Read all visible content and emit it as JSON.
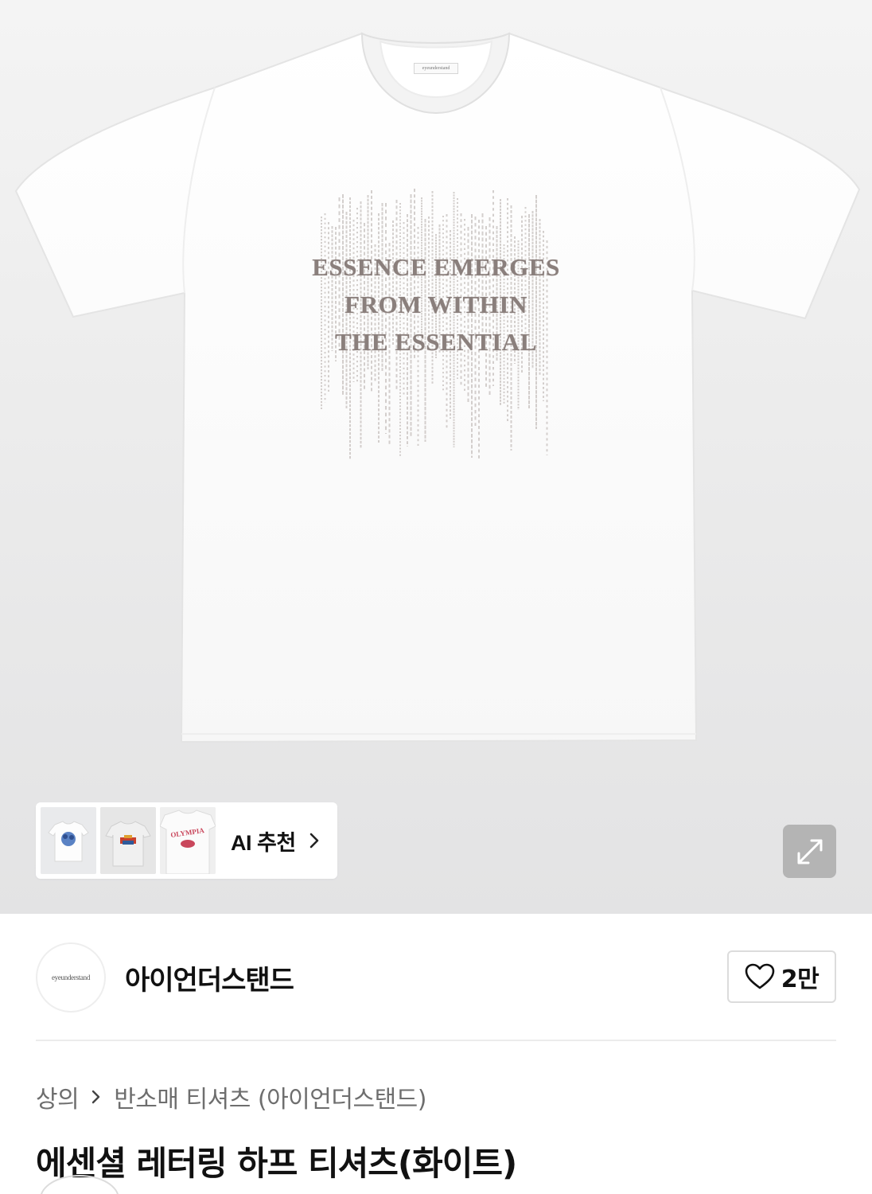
{
  "product_image": {
    "print_lines": [
      "ESSENCE EMERGES",
      "FROM WITHIN",
      "THE ESSENTIAL"
    ],
    "neck_label": "eyeunderstand"
  },
  "ai_recommend": {
    "label": "AI 추천",
    "thumbnails": [
      {
        "icon": "blue-graphic-tee-thumbnail"
      },
      {
        "icon": "red-graphic-tee-thumbnail"
      },
      {
        "icon": "olympia-tee-thumbnail",
        "text": "OLYMPIA"
      }
    ]
  },
  "expand_button": {
    "icon": "expand-icon"
  },
  "brand": {
    "avatar_text": "eyeunderstand",
    "name": "아이언더스탠드",
    "like_count": "2만"
  },
  "breadcrumb": {
    "items": [
      "상의",
      "반소매 티셔츠 (아이언더스탠드)"
    ]
  },
  "product": {
    "title": "에센셜 레터링 하프 티셔츠(화이트)"
  },
  "colors": {
    "print": "#8a7f7c",
    "background_top": "#f4f4f4",
    "background_bottom": "#e3e3e4"
  }
}
